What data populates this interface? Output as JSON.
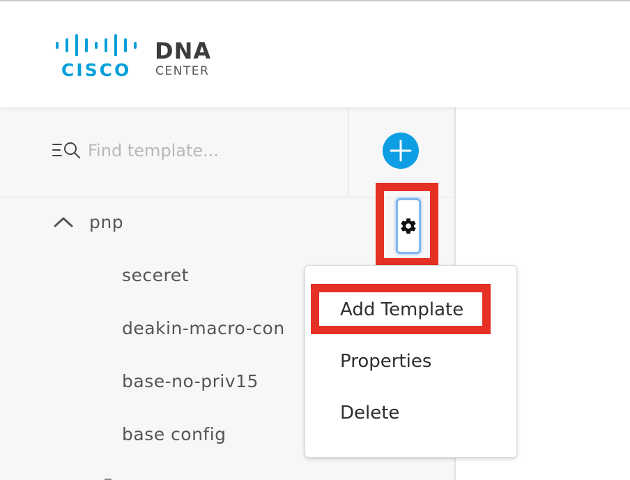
{
  "header": {
    "logo_word": "CISCO",
    "product_name": "DNA",
    "product_subtitle": "CENTER"
  },
  "search": {
    "placeholder": "Find template...",
    "value": "",
    "icon": "filter-search-icon"
  },
  "add_button": {
    "icon": "plus-icon"
  },
  "tree": {
    "group": {
      "label": "pnp",
      "expanded": true,
      "icon": "chevron-up-icon"
    },
    "items": [
      {
        "label": "seceret"
      },
      {
        "label": "deakin-macro-con"
      },
      {
        "label": "base-no-priv15"
      },
      {
        "label": "base config"
      }
    ]
  },
  "gear_button": {
    "icon": "gear-icon"
  },
  "context_menu": {
    "items": [
      {
        "label": "Add Template",
        "highlighted": true
      },
      {
        "label": "Properties"
      },
      {
        "label": "Delete"
      }
    ]
  },
  "colors": {
    "cisco_blue": "#049fd9",
    "add_button": "#0d9ee3",
    "highlight_red": "#e53024",
    "sidebar_bg": "#f7f7f7"
  }
}
